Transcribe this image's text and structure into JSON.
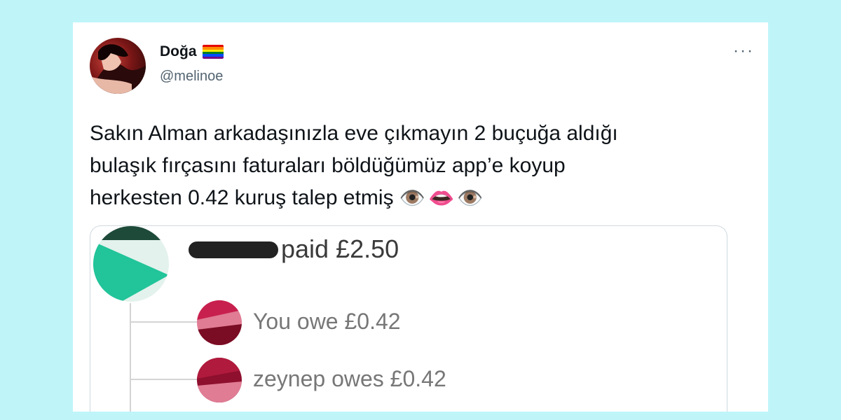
{
  "tweet": {
    "display_name": "Doğa",
    "handle": "@melinoe",
    "more_label": "···",
    "text_lines": [
      "Sakın Alman arkadaşınızla eve çıkmayın 2 buçuğa aldığı",
      "bulaşık fırçasını faturaları böldüğümüz app’e koyup",
      "herkesten 0.42 kuruş talep etmiş"
    ],
    "emojis": [
      "👁️",
      "👄",
      "👁️"
    ],
    "emoji_names": [
      "eye-icon",
      "mouth-icon",
      "eye-icon"
    ],
    "flag_colors": [
      "#e40303",
      "#ff8c00",
      "#ffed00",
      "#008026",
      "#004dff",
      "#750787"
    ]
  },
  "media": {
    "payer_text": "paid £2.50",
    "debts": [
      {
        "text": "You owe £0.42",
        "avatar_colors": [
          "#c8204e",
          "#e07c94",
          "#7a0c24"
        ]
      },
      {
        "text": "zeynep owes £0.42",
        "avatar_colors": [
          "#8e0f2e",
          "#e07c94",
          "#5a0818"
        ]
      }
    ],
    "payer_avatar_colors": [
      "#1e4a3a",
      "#22c49a",
      "#e3f2ec"
    ]
  }
}
